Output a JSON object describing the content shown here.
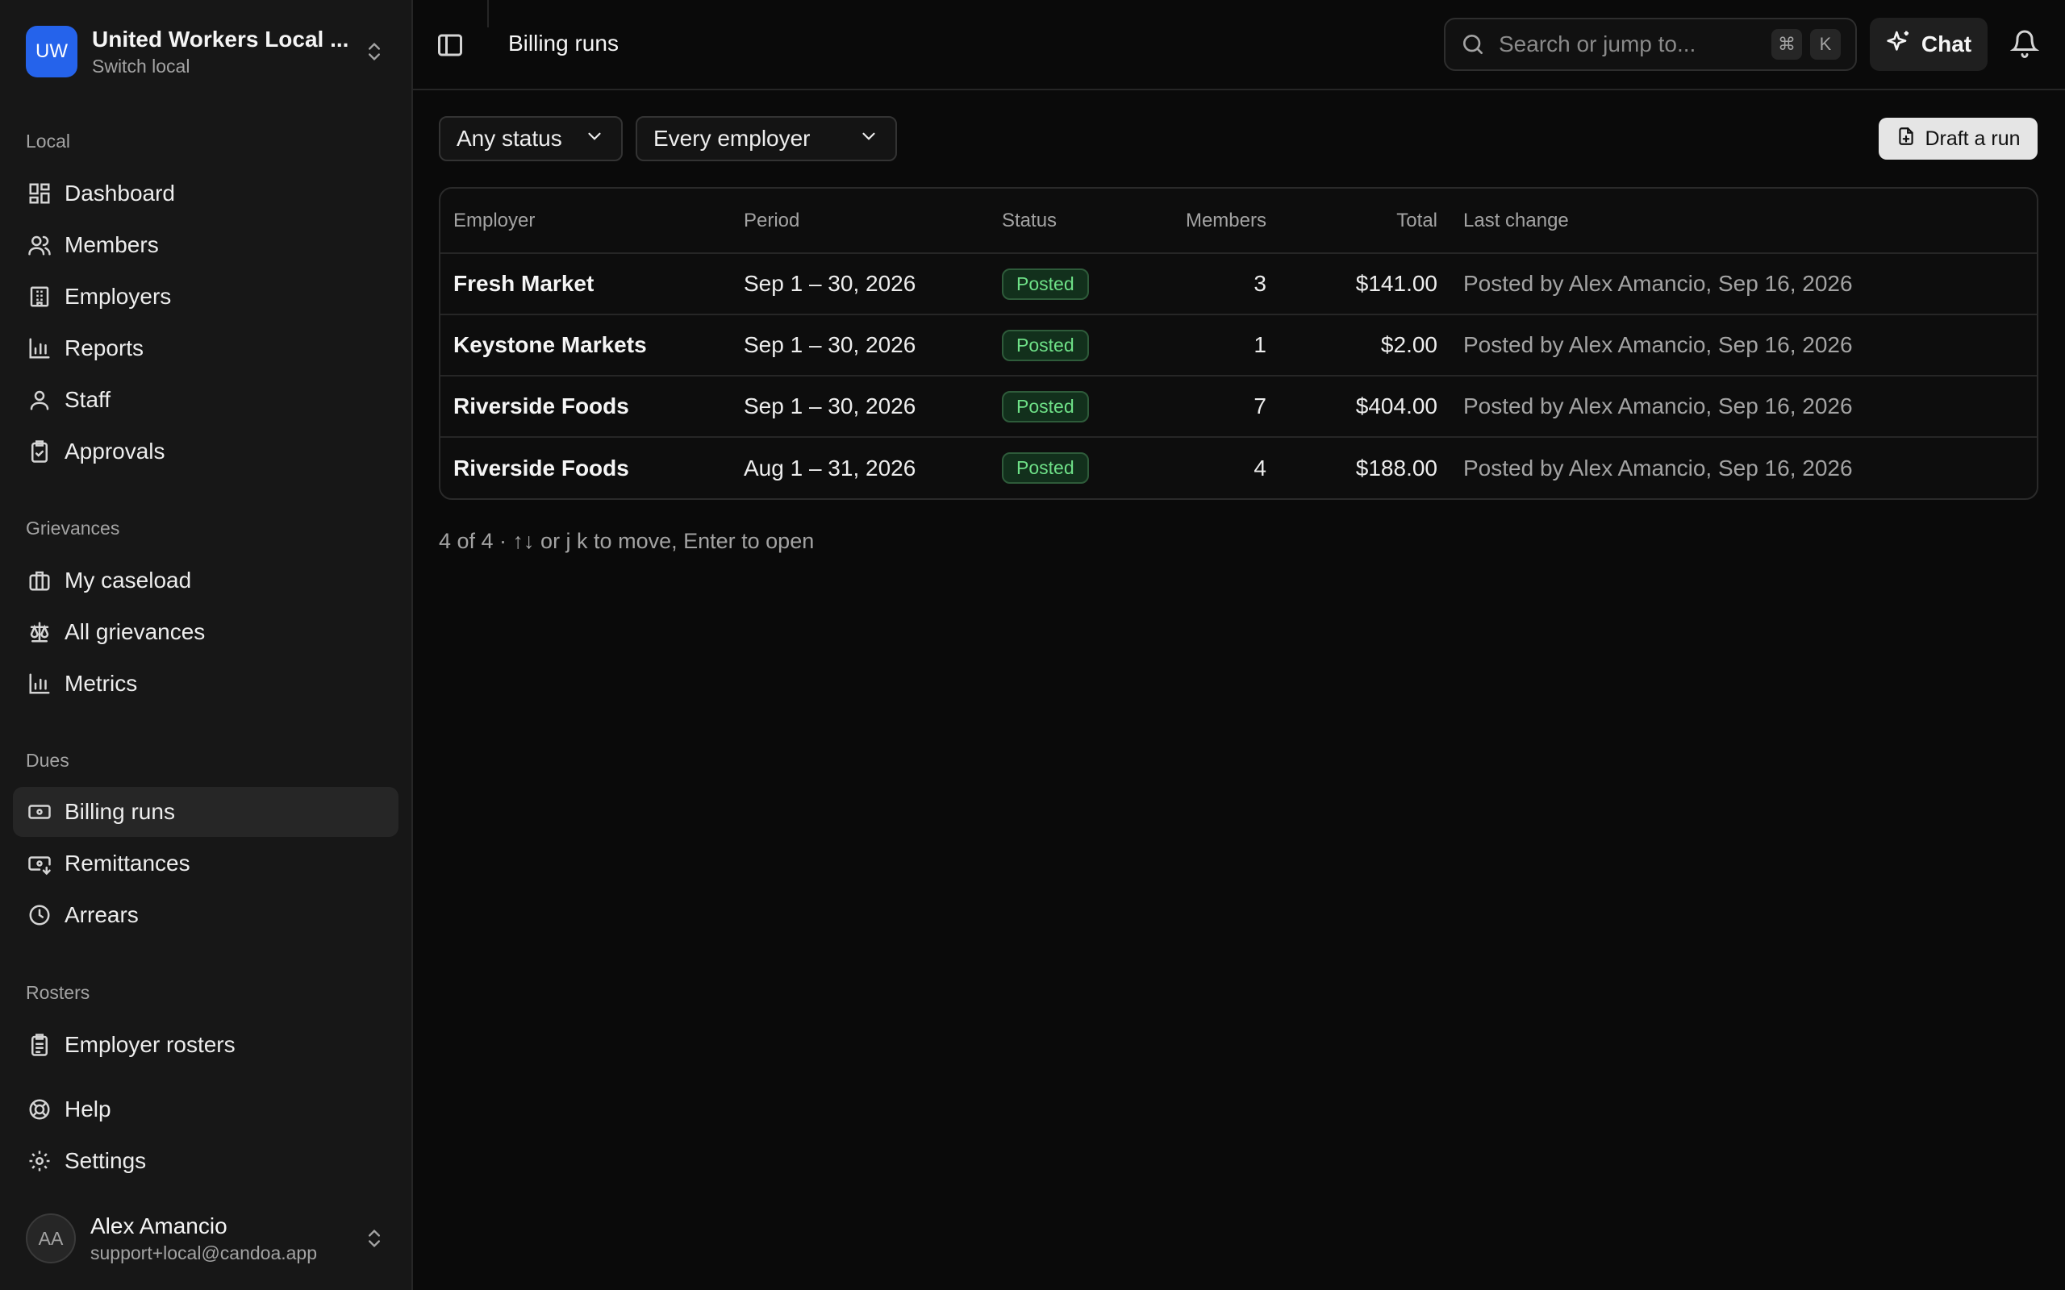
{
  "org": {
    "initials": "UW",
    "name": "United Workers Local ...",
    "sub": "Switch local"
  },
  "sections": {
    "local": "Local",
    "grievances": "Grievances",
    "dues": "Dues",
    "rosters": "Rosters"
  },
  "nav": {
    "dashboard": "Dashboard",
    "members": "Members",
    "employers": "Employers",
    "reports": "Reports",
    "staff": "Staff",
    "approvals": "Approvals",
    "my_caseload": "My caseload",
    "all_grievances": "All grievances",
    "metrics": "Metrics",
    "billing_runs": "Billing runs",
    "remittances": "Remittances",
    "arrears": "Arrears",
    "employer_rosters": "Employer rosters",
    "help": "Help",
    "settings": "Settings"
  },
  "user": {
    "initials": "AA",
    "name": "Alex Amancio",
    "email": "support+local@candoa.app"
  },
  "topbar": {
    "title": "Billing runs",
    "search_placeholder": "Search or jump to...",
    "kbd_cmd": "⌘",
    "kbd_k": "K",
    "chat_label": "Chat"
  },
  "filters": {
    "status": "Any status",
    "employer": "Every employer",
    "draft_label": "Draft a run"
  },
  "table": {
    "headers": {
      "employer": "Employer",
      "period": "Period",
      "status": "Status",
      "members": "Members",
      "total": "Total",
      "last_change": "Last change"
    },
    "rows": [
      {
        "employer": "Fresh Market",
        "period": "Sep 1 – 30, 2026",
        "status": "Posted",
        "members": "3",
        "total": "$141.00",
        "last_change": "Posted by Alex Amancio, Sep 16, 2026"
      },
      {
        "employer": "Keystone Markets",
        "period": "Sep 1 – 30, 2026",
        "status": "Posted",
        "members": "1",
        "total": "$2.00",
        "last_change": "Posted by Alex Amancio, Sep 16, 2026"
      },
      {
        "employer": "Riverside Foods",
        "period": "Sep 1 – 30, 2026",
        "status": "Posted",
        "members": "7",
        "total": "$404.00",
        "last_change": "Posted by Alex Amancio, Sep 16, 2026"
      },
      {
        "employer": "Riverside Foods",
        "period": "Aug 1 – 31, 2026",
        "status": "Posted",
        "members": "4",
        "total": "$188.00",
        "last_change": "Posted by Alex Amancio, Sep 16, 2026"
      }
    ]
  },
  "footer_note": "4 of 4 · ↑↓ or j k to move, Enter to open"
}
